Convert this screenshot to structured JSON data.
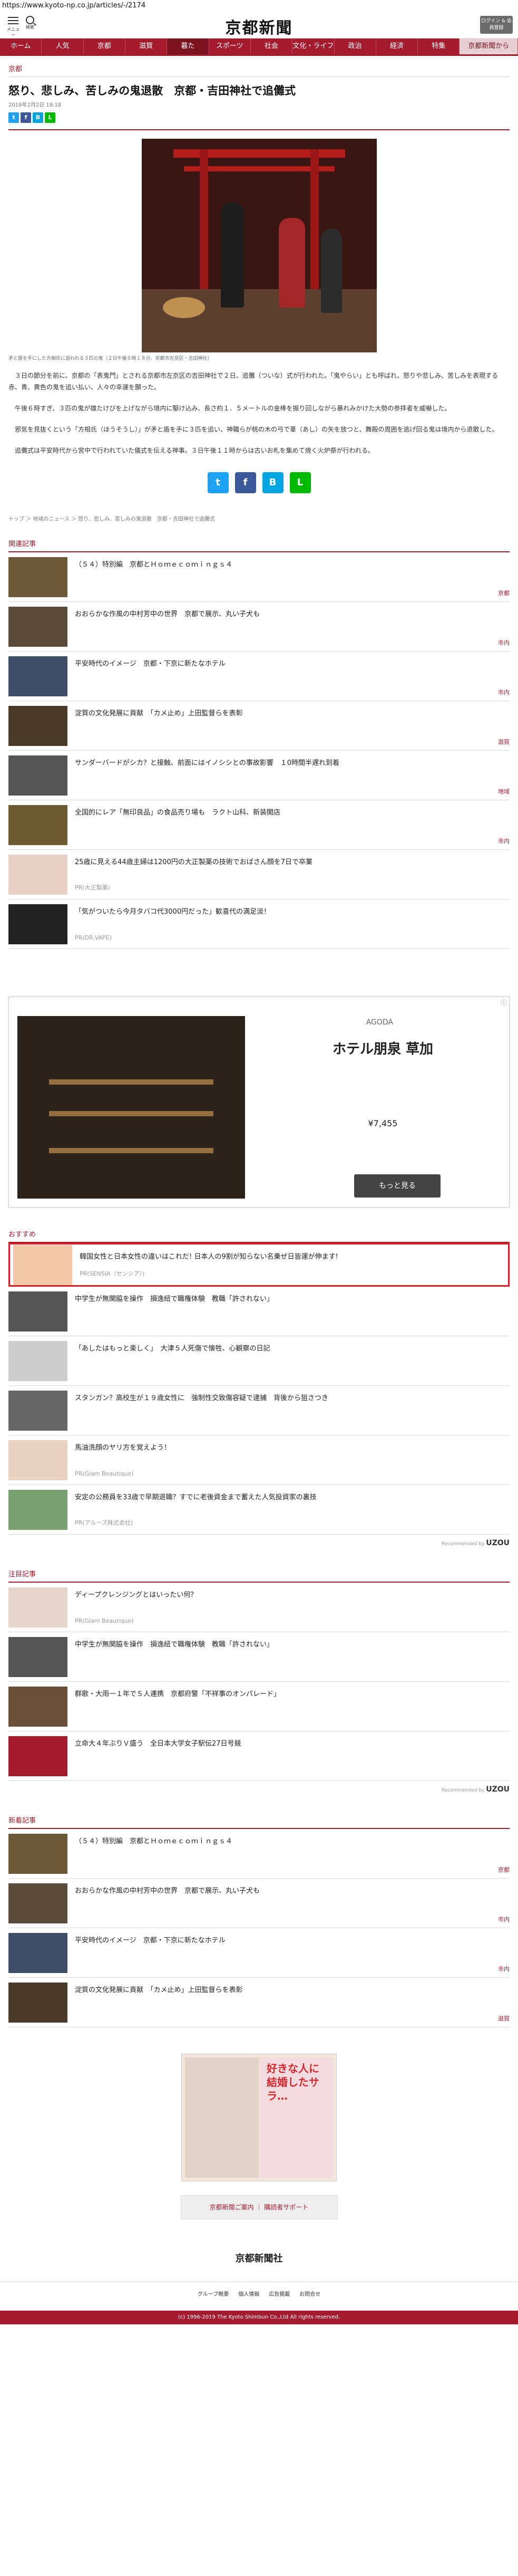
{
  "url": "https://www.kyoto-np.co.jp/articles/-/2174",
  "header": {
    "logo": "京都新聞",
    "menu_label": "メニュー",
    "search_label": "検索",
    "account_label": "ログイン &\n会員登録"
  },
  "nav": [
    "ホーム",
    "人気",
    "京都",
    "滋賀",
    "暮た",
    "スポーツ",
    "社会",
    "文化・ライフ",
    "政治",
    "経済",
    "特集",
    "京都新聞から"
  ],
  "nav_active": 4,
  "section": "京都",
  "article": {
    "title": "怒り、悲しみ、苦しみの鬼退散　京都・吉田神社で追儺式",
    "date": "2019年2月2日 18:18",
    "caption": "矛と盾を手にした方相氏に追われる３匹の鬼（２日午後６時１８分、京都市左京区・吉田神社）",
    "paragraphs": [
      "３日の節分を前に、京都の「表鬼門」とされる京都市左京区の吉田神社で２日、追儺（ついな）式が行われた。「鬼やらい」とも呼ばれ、怒りや悲しみ、苦しみを表現する赤、青、黄色の鬼を追い払い、人々の幸運を願った。",
      "午後６時すぎ、３匹の鬼が雄たけびを上げながら境内に駆け込み、長さ約１．５メートルの金棒を振り回しながら暴れみかけた大勢の参拝者を威嚇した。",
      "邪気を見抜くという「方相氏（ほうそうし）」が矛と盾を手に３匹を追い、神職らが桃の木の弓で葦（あし）の矢を放つと、舞殿の周囲を逃げ回る鬼は境内から退散した。",
      "追儺式は平安時代から宮中で行われていた儀式を伝える神事。３日午後１１時からは古いお札を集めて焼く火炉祭が行われる。"
    ],
    "breadcrumb": "トップ ＞ 地域のニュース ＞ 怒り、悲しみ、苦しみの鬼退散　京都・吉田神社で追儺式"
  },
  "related": {
    "title": "関連記事",
    "items": [
      {
        "title": "（５４）特別編　京都とＨｏｍｅｃｏｍｉｎｇｓ４",
        "cat": "京都",
        "color": "#6b5a3a"
      },
      {
        "title": "おおらかな作風の中村芳中の世界　京都で展示、丸い子犬も",
        "cat": "市内",
        "color": "#5a4a3a"
      },
      {
        "title": "平安時代のイメージ　京都・下京に新たなホテル",
        "cat": "市内",
        "color": "#3d4e66"
      },
      {
        "title": "淀質の文化発展に貢献　「カメ止め」上田監督らを表彰",
        "cat": "滋賀",
        "color": "#4a3a2a"
      },
      {
        "title": "サンダーバードがシカ？と接触、前面にはイノシシとの事故影響　１0時間半遅れ到着",
        "cat": "地域",
        "color": "#555"
      },
      {
        "title": "全国的にレア「無印良品」の食品売り場も　ラクト山科、新装開店",
        "cat": "市内",
        "color": "#6a5a30"
      },
      {
        "title": "25歳に見える44歳主婦は1200円の大正製薬の技術でおばさん顔を7日で卒業",
        "pr": "PR(大正製薬)",
        "color": "#e6d2c6"
      },
      {
        "title": "「気がついたら今月タバコ代3000円だった」歓喜代の満足淡！",
        "pr": "PR(DR.VAPE)",
        "color": "#222"
      }
    ]
  },
  "ad": {
    "sponsor": "AGODA",
    "title": "ホテル朋泉 草加",
    "price": "¥7,455",
    "button": "もっと見る"
  },
  "recommend": {
    "title": "おすすめ",
    "highlight": {
      "title": "韓国女性と日本女性の違いはこれだ! 日本人の9割が知らない名乗ぜ日皆運が伸ます!",
      "pr": "PR(SENSIA（センシア）)"
    },
    "items": [
      {
        "title": "中学生が無関脇を操作　損逸紐で職権体験　教職「許されない」",
        "color": "#555"
      },
      {
        "title": "「あしたはもっと楽しく」　大津５人死傷で懐牲、心観察の日記",
        "color": "#ccc"
      },
      {
        "title": "スタンガン？高校生が１９歳女性に　強制性交致傷容疑で逮捕　背後から狙さつき",
        "color": "#666"
      },
      {
        "title": "馬油洗顔のヤリ方を覚えよう！",
        "pr": "PR(Glam Beautique)",
        "color": "#e8d2c2"
      },
      {
        "title": "安定の公務員を33歳で早期退職？すでに老後資金まで蓄えた人気投資家の裏技",
        "pr": "PR(アルーズ株式会社)",
        "color": "#7aa070"
      }
    ],
    "powered": "Recommended by"
  },
  "attention": {
    "title": "注目記事",
    "items": [
      {
        "title": "ディープクレンジングとはいったい何？",
        "pr": "PR(Glam Beautique)",
        "color": "#e8d6cc"
      },
      {
        "title": "中学生が無関脇を操作　損逸紐で職権体験　教職「許されない」",
        "color": "#555"
      },
      {
        "title": "群歌・大雨一１年で５人連携　京都府警「不祥事のオンパレード」",
        "color": "#6a4e3a"
      },
      {
        "title": "立命大４年ぶりＶ盛う　全日本大学女子駅伝27日号競",
        "color": "#a41b2e"
      }
    ],
    "powered": "Recommended by"
  },
  "latest": {
    "title": "新着記事",
    "items": [
      {
        "title": "（５４）特別編　京都とＨｏｍｅｃｏｍｉｎｇｓ４",
        "cat": "京都",
        "color": "#6b5a3a"
      },
      {
        "title": "おおらかな作風の中村芳中の世界　京都で展示、丸い子犬も",
        "cat": "市内",
        "color": "#5a4a3a"
      },
      {
        "title": "平安時代のイメージ　京都・下京に新たなホテル",
        "cat": "市内",
        "color": "#3d4e66"
      },
      {
        "title": "淀質の文化発展に貢献　「カメ止め」上田監督らを表彰",
        "cat": "滋賀",
        "color": "#4a3a2a"
      }
    ]
  },
  "manga_ad": {
    "text": "好きな人に結婚したサラ…"
  },
  "footer": {
    "button": "京都新聞ご案内 ｜ 購読者サポート",
    "logo": "京都新聞社",
    "links": [
      "グループ概要",
      "個人情報",
      "広告掲載",
      "お問合せ"
    ],
    "copyright": "(c) 1996-2019 The Kyoto Shimbun Co.,Ltd All rights reserved."
  }
}
